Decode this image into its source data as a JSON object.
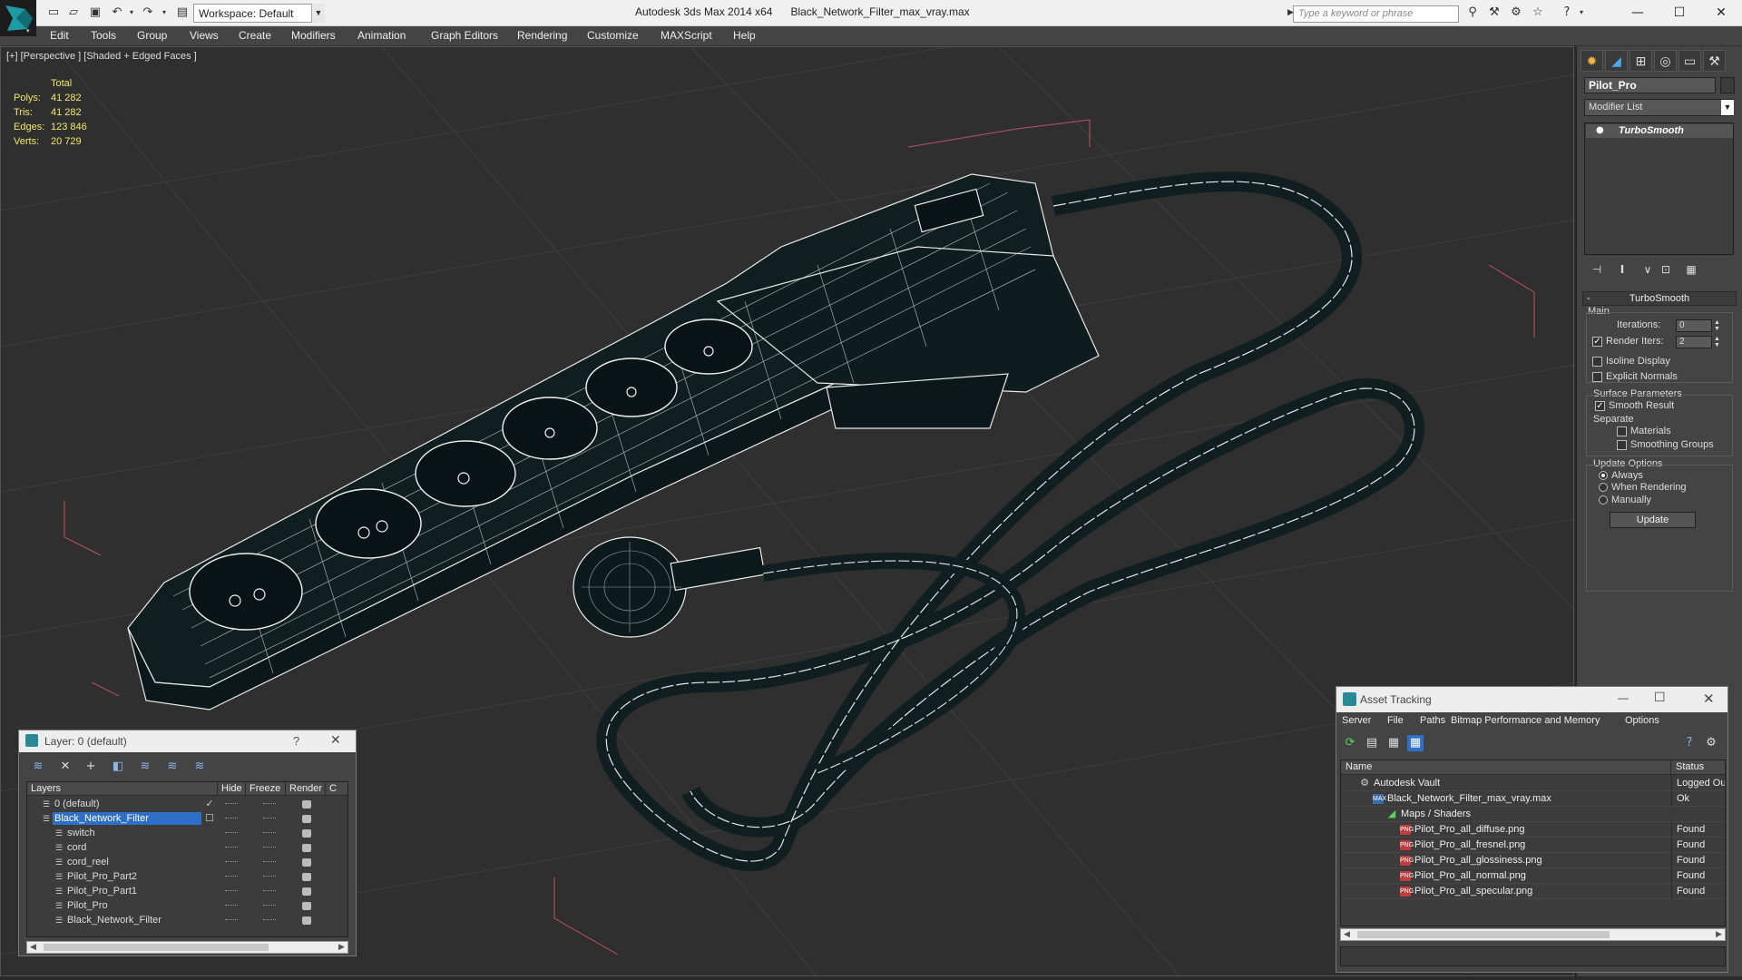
{
  "titlebar": {
    "workspace": "Workspace: Default",
    "app_title": "Autodesk 3ds Max 2014 x64",
    "file_title": "Black_Network_Filter_max_vray.max",
    "search_placeholder": "Type a keyword or phrase",
    "min": "—",
    "max": "☐",
    "close": "✕"
  },
  "menu": [
    "Edit",
    "Tools",
    "Group",
    "Views",
    "Create",
    "Modifiers",
    "Animation",
    "Graph Editors",
    "Rendering",
    "Customize",
    "MAXScript",
    "Help"
  ],
  "viewport": {
    "label": "[+] [Perspective ] [Shaded + Edged Faces ]",
    "stats_header": "Total",
    "stats": [
      {
        "label": "Polys:",
        "value": "41 282"
      },
      {
        "label": "Tris:",
        "value": "41 282"
      },
      {
        "label": "Edges:",
        "value": "123 846"
      },
      {
        "label": "Verts:",
        "value": "20 729"
      }
    ],
    "colors": {
      "background": "#2f2f2f",
      "grid": "#3d3d3d",
      "wire": "#ffffff",
      "mesh_fill": "#0e2325",
      "selection_bracket": "#c0506a",
      "stats": "#f2e86a"
    }
  },
  "command_panel": {
    "object_name": "Pilot_Pro",
    "modifier_list": "Modifier List",
    "stack_item": "TurboSmooth",
    "rollout_title": "TurboSmooth",
    "main_label": "Main",
    "iterations_label": "Iterations:",
    "iterations_value": "0",
    "render_iters_label": "Render Iters:",
    "render_iters_value": "2",
    "isoline_label": "Isoline Display",
    "explicit_normals_label": "Explicit Normals",
    "surface_params_label": "Surface Parameters",
    "smooth_result_label": "Smooth Result",
    "separate_label": "Separate",
    "materials_label": "Materials",
    "smoothing_groups_label": "Smoothing Groups",
    "update_options_label": "Update Options",
    "always_label": "Always",
    "when_rendering_label": "When Rendering",
    "manually_label": "Manually",
    "update_button": "Update",
    "render_iters_checked": true,
    "smooth_result_checked": true,
    "selected_update_option": "Always"
  },
  "layer_dialog": {
    "title": "Layer: 0 (default)",
    "help": "?",
    "close": "✕",
    "columns": [
      "Layers",
      "Hide",
      "Freeze",
      "Render",
      "C"
    ],
    "rows": [
      {
        "name": "0 (default)",
        "indent": 1,
        "selected": false,
        "active": true
      },
      {
        "name": "Black_Network_Filter",
        "indent": 1,
        "selected": true,
        "active": false
      },
      {
        "name": "switch",
        "indent": 2,
        "selected": false,
        "active": false
      },
      {
        "name": "cord",
        "indent": 2,
        "selected": false,
        "active": false
      },
      {
        "name": "cord_reel",
        "indent": 2,
        "selected": false,
        "active": false
      },
      {
        "name": "Pilot_Pro_Part2",
        "indent": 2,
        "selected": false,
        "active": false
      },
      {
        "name": "Pilot_Pro_Part1",
        "indent": 2,
        "selected": false,
        "active": false
      },
      {
        "name": "Pilot_Pro",
        "indent": 2,
        "selected": false,
        "active": false
      },
      {
        "name": "Black_Network_Filter",
        "indent": 2,
        "selected": false,
        "active": false
      }
    ]
  },
  "asset_dialog": {
    "title": "Asset Tracking",
    "min": "—",
    "max": "☐",
    "close": "✕",
    "menu": [
      "Server",
      "File",
      "Paths",
      "Bitmap Performance and Memory",
      "Options"
    ],
    "columns": [
      "Name",
      "Status"
    ],
    "rows": [
      {
        "name": "Autodesk Vault",
        "indent": 0,
        "icon": "vault",
        "status": "Logged Out"
      },
      {
        "name": "Black_Network_Filter_max_vray.max",
        "indent": 1,
        "icon": "max",
        "status": "Ok"
      },
      {
        "name": "Maps / Shaders",
        "indent": 2,
        "icon": "maps",
        "status": ""
      },
      {
        "name": "Pilot_Pro_all_diffuse.png",
        "indent": 3,
        "icon": "png",
        "status": "Found"
      },
      {
        "name": "Pilot_Pro_all_fresnel.png",
        "indent": 3,
        "icon": "png",
        "status": "Found"
      },
      {
        "name": "Pilot_Pro_all_glossiness.png",
        "indent": 3,
        "icon": "png",
        "status": "Found"
      },
      {
        "name": "Pilot_Pro_all_normal.png",
        "indent": 3,
        "icon": "png",
        "status": "Found"
      },
      {
        "name": "Pilot_Pro_all_specular.png",
        "indent": 3,
        "icon": "png",
        "status": "Found"
      }
    ]
  }
}
